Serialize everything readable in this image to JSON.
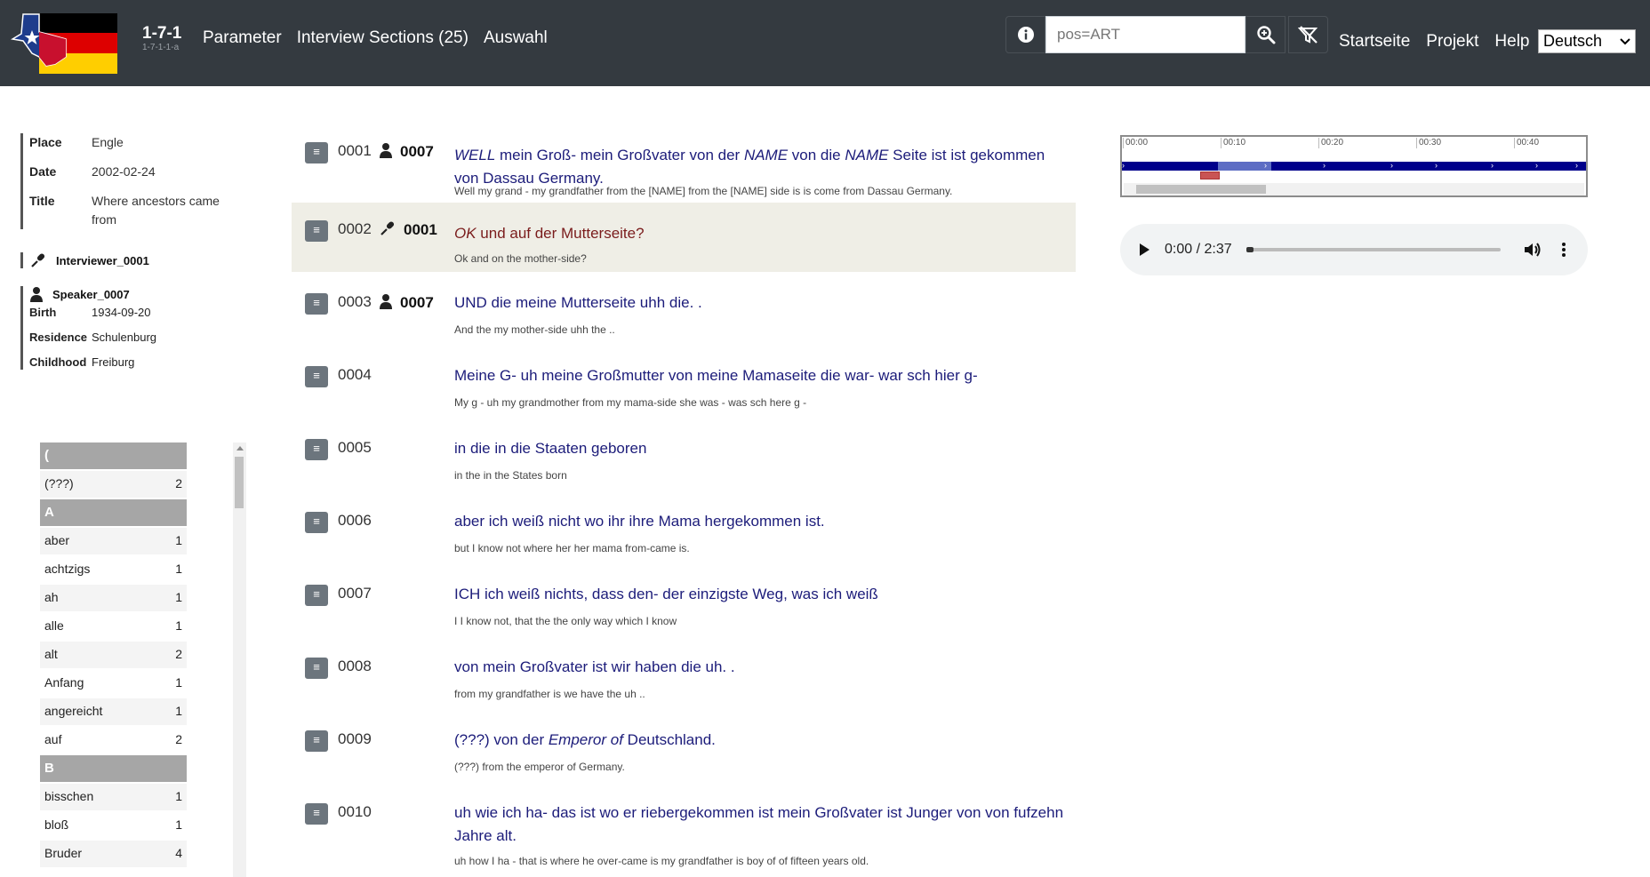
{
  "header": {
    "brand_main": "1-7-1",
    "brand_sub": "1-7-1-1-a",
    "nav": [
      "Parameter",
      "Interview Sections (25)",
      "Auswahl"
    ],
    "search_value": "pos=ART",
    "right_nav": [
      "Startseite",
      "Projekt",
      "Help"
    ],
    "language": "Deutsch",
    "colors": {
      "navbar": "#343a40",
      "transcript_text": "#1c1c7a",
      "highlight_bg": "#efeee6"
    }
  },
  "meta": {
    "place_label": "Place",
    "place": "Engle",
    "date_label": "Date",
    "date": "2002-02-24",
    "title_label": "Title",
    "title": "Where ancestors came from"
  },
  "interviewer": {
    "name": "Interviewer_0001"
  },
  "speaker": {
    "name": "Speaker_0007",
    "birth_label": "Birth",
    "birth": "1934-09-20",
    "residence_label": "Residence",
    "residence": "Schulenburg",
    "childhood_label": "Childhood",
    "childhood": "Freiburg"
  },
  "wordlist": [
    {
      "type": "group",
      "label": "("
    },
    {
      "type": "word",
      "word": "(???)",
      "count": "2"
    },
    {
      "type": "group",
      "label": "A"
    },
    {
      "type": "word",
      "word": "aber",
      "count": "1"
    },
    {
      "type": "word",
      "word": "achtzigs",
      "count": "1"
    },
    {
      "type": "word",
      "word": "ah",
      "count": "1"
    },
    {
      "type": "word",
      "word": "alle",
      "count": "1"
    },
    {
      "type": "word",
      "word": "alt",
      "count": "2"
    },
    {
      "type": "word",
      "word": "Anfang",
      "count": "1"
    },
    {
      "type": "word",
      "word": "angereicht",
      "count": "1"
    },
    {
      "type": "word",
      "word": "auf",
      "count": "2"
    },
    {
      "type": "group",
      "label": "B"
    },
    {
      "type": "word",
      "word": "bisschen",
      "count": "1"
    },
    {
      "type": "word",
      "word": "bloß",
      "count": "1"
    },
    {
      "type": "word",
      "word": "Bruder",
      "count": "4"
    }
  ],
  "segments": [
    {
      "num": "0001",
      "speaker_icon": "speaker-person-icon",
      "speaker": "0007",
      "parts": [
        [
          "i",
          "WELL"
        ],
        [
          "t",
          " mein Groß- mein Großvater von der "
        ],
        [
          "i",
          "NAME"
        ],
        [
          "t",
          " von die "
        ],
        [
          "i",
          "NAME"
        ],
        [
          "t",
          " Seite ist ist gekommen von Dassau Germany."
        ]
      ],
      "translation": "Well my grand - my grandfather from the [NAME] from the [NAME] side is is come from Dassau Germany."
    },
    {
      "num": "0002",
      "speaker_icon": "interviewer-microphone-icon",
      "speaker": "0001",
      "highlight": true,
      "parts": [
        [
          "i",
          "OK"
        ],
        [
          "t",
          " und auf der Mutterseite?"
        ]
      ],
      "translation": "Ok and on the mother-side?"
    },
    {
      "num": "0003",
      "speaker_icon": "speaker-person-icon",
      "speaker": "0007",
      "parts": [
        [
          "t",
          "UND die meine Mutterseite uhh die. ."
        ]
      ],
      "translation": "And the my mother-side uhh the .."
    },
    {
      "num": "0004",
      "parts": [
        [
          "t",
          "Meine G- uh meine Großmutter von meine Mamaseite die war- war sch hier g-"
        ]
      ],
      "translation": "My g - uh my grandmother from my mama-side she was - was sch here g -"
    },
    {
      "num": "0005",
      "parts": [
        [
          "t",
          "in die in die Staaten geboren"
        ]
      ],
      "translation": "in the in the States born"
    },
    {
      "num": "0006",
      "parts": [
        [
          "t",
          "aber ich weiß nicht wo ihr ihre Mama hergekommen ist."
        ]
      ],
      "translation": "but I know not where her her mama from-came is."
    },
    {
      "num": "0007",
      "parts": [
        [
          "t",
          "ICH ich weiß nichts, dass den- der einzigste Weg, was ich weiß"
        ]
      ],
      "translation": "I I know not, that the the only way which I know"
    },
    {
      "num": "0008",
      "parts": [
        [
          "t",
          "von mein Großvater ist wir haben die uh. ."
        ]
      ],
      "translation": "from my grandfather is we have the uh .."
    },
    {
      "num": "0009",
      "parts": [
        [
          "t",
          "(???) von der "
        ],
        [
          "i",
          "Emperor of"
        ],
        [
          "t",
          " Deutschland."
        ]
      ],
      "translation": "(???) from the emperor of Germany."
    },
    {
      "num": "0010",
      "parts": [
        [
          "t",
          "uh wie ich ha- das ist wo er riebergekommen ist mein Großvater ist Junger von von fufzehn Jahre alt."
        ]
      ],
      "translation": "uh how I ha - that is where he over-came is my grandfather is boy of of fifteen years old."
    }
  ],
  "timeline": {
    "ticks": [
      "00:00",
      "00:10",
      "00:20",
      "00:30",
      "00:40"
    ]
  },
  "audio": {
    "time": "0:00 / 2:37",
    "progress": 0.0
  }
}
